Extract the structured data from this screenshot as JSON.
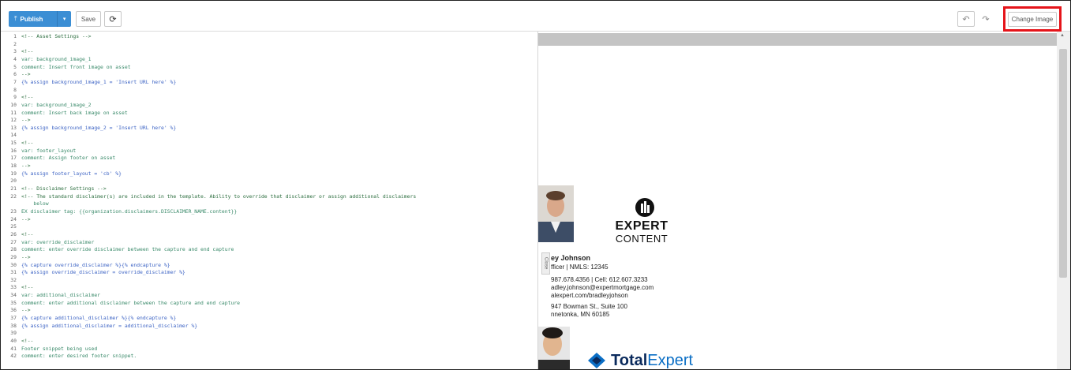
{
  "toolbar": {
    "publish_label": "Publish",
    "save_label": "Save",
    "change_image_label": "Change Image",
    "accent_color": "#3b8ed4",
    "highlight_color": "#e5141a"
  },
  "editor": {
    "lines": [
      {
        "num": "1",
        "text": "<!-- Asset Settings -->"
      },
      {
        "num": "2",
        "text": ""
      },
      {
        "num": "3",
        "text": "<!--"
      },
      {
        "num": "4",
        "text": "var: background_image_1"
      },
      {
        "num": "5",
        "text": "comment: Insert front image on asset"
      },
      {
        "num": "6",
        "text": "-->"
      },
      {
        "num": "7",
        "text": "{% assign background_image_1 = 'Insert URL here' %}"
      },
      {
        "num": "8",
        "text": ""
      },
      {
        "num": "9",
        "text": "<!--"
      },
      {
        "num": "10",
        "text": "var: background_image_2"
      },
      {
        "num": "11",
        "text": "comment: Insert back image on asset"
      },
      {
        "num": "12",
        "text": "-->"
      },
      {
        "num": "13",
        "text": "{% assign background_image_2 = 'Insert URL here' %}"
      },
      {
        "num": "14",
        "text": ""
      },
      {
        "num": "15",
        "text": "<!--"
      },
      {
        "num": "16",
        "text": "var: footer_layout"
      },
      {
        "num": "17",
        "text": "comment: Assign footer on asset"
      },
      {
        "num": "18",
        "text": "-->"
      },
      {
        "num": "19",
        "text": "{% assign footer_layout = 'cb' %}"
      },
      {
        "num": "20",
        "text": ""
      },
      {
        "num": "21",
        "text": "<!-- Disclaimer Settings -->"
      },
      {
        "num": "22",
        "text": "<!-- The standard disclaimer(s) are included in the template. Ability to override that disclaimer or assign additional disclaimers"
      },
      {
        "num": "",
        "text": "    below"
      },
      {
        "num": "23",
        "text": "EX disclaimer tag: {{organization.disclaimers.DISCLAIMER_NAME.content}}"
      },
      {
        "num": "24",
        "text": "-->"
      },
      {
        "num": "25",
        "text": ""
      },
      {
        "num": "26",
        "text": "<!--"
      },
      {
        "num": "27",
        "text": "var: override_disclaimer"
      },
      {
        "num": "28",
        "text": "comment: enter override disclaimer between the capture and end capture"
      },
      {
        "num": "29",
        "text": "-->"
      },
      {
        "num": "30",
        "text": "{% capture override_disclaimer %}{% endcapture %}"
      },
      {
        "num": "31",
        "text": "{% assign override_disclaimer = override_disclaimer %}"
      },
      {
        "num": "32",
        "text": ""
      },
      {
        "num": "33",
        "text": "<!--"
      },
      {
        "num": "34",
        "text": "var: additional_disclaimer"
      },
      {
        "num": "35",
        "text": "comment: enter additional disclaimer between the capture and end capture"
      },
      {
        "num": "36",
        "text": "-->"
      },
      {
        "num": "37",
        "text": "{% capture additional_disclaimer %}{% endcapture %}"
      },
      {
        "num": "38",
        "text": "{% assign additional_disclaimer = additional_disclaimer %}"
      },
      {
        "num": "39",
        "text": ""
      },
      {
        "num": "40",
        "text": "<!--"
      },
      {
        "num": "41",
        "text": "Footer snippet being used"
      },
      {
        "num": "42",
        "text": "comment: enter desired footer snippet."
      }
    ]
  },
  "preview": {
    "close_label": "Close",
    "brand_line1": "EXPERT",
    "brand_line2": "CONTENT",
    "signature": {
      "name": "ey Johnson",
      "title": "fficer | NMLS: 12345",
      "phone": "987.678.4356 | Cell: 612.607.3233",
      "email": "adley.johnson@expertmortgage.com",
      "web": "alexpert.com/bradleyjohson",
      "address1": "947 Bowman St., Suite 100",
      "address2": "nnetonka, MN 60185"
    },
    "logo_part1": "Total",
    "logo_part2": "Expert"
  }
}
